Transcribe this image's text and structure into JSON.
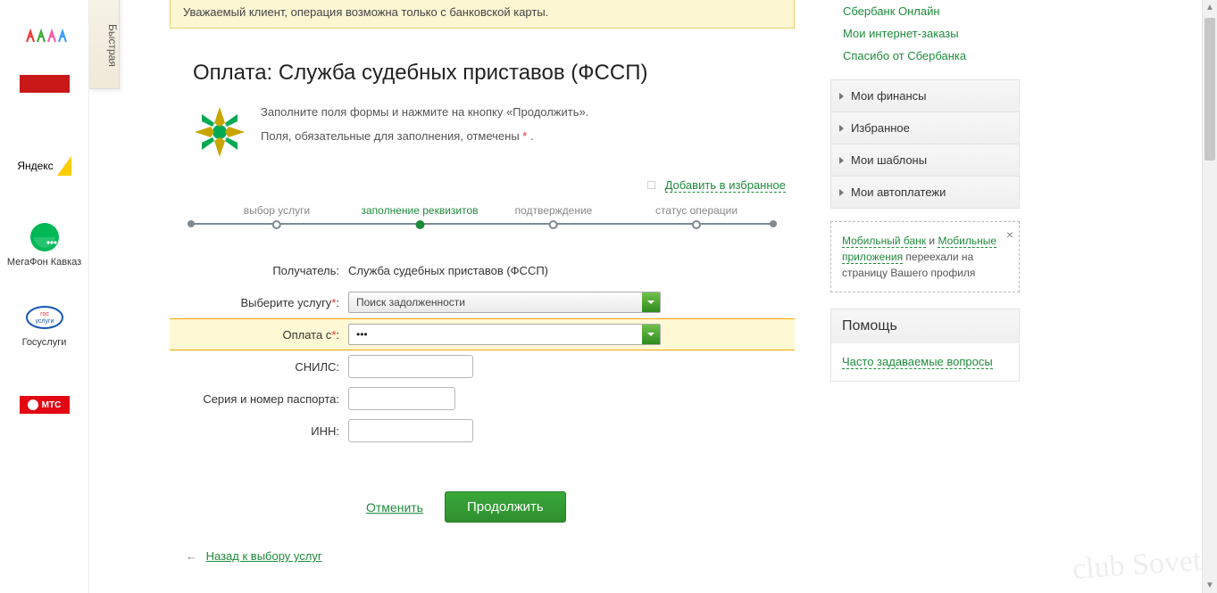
{
  "left_rail": {
    "fast_label": "Быстрая",
    "items": [
      {
        "label": "",
        "kind": "kids"
      },
      {
        "label": "",
        "kind": "promo"
      },
      {
        "label": "Яндекс",
        "kind": "yandex"
      },
      {
        "label": "МегаФон Кавказ",
        "kind": "megafon"
      },
      {
        "label": "Госуслуги",
        "kind": "gosuslugi"
      },
      {
        "label": "",
        "kind": "mts"
      }
    ]
  },
  "alert": "Уважаемый клиент, операция возможна только с банковской карты.",
  "title": "Оплата: Служба судебных приставов (ФССП)",
  "intro1": "Заполните поля формы и нажмите на кнопку «Продолжить».",
  "intro2_pre": "Поля, обязательные для заполнения, отмечены ",
  "intro2_post": " .",
  "fav_label": "Добавить в избранное",
  "steps": [
    "выбор услуги",
    "заполнение реквизитов",
    "подтверждение",
    "статус операции"
  ],
  "active_step_index": 1,
  "form": {
    "recipient_label": "Получатель:",
    "recipient_value": "Служба судебных приставов (ФССП)",
    "service_label": "Выберите услугу",
    "service_value": "Поиск задолженности",
    "payfrom_label": "Оплата с",
    "payfrom_value": "•••",
    "snils_label": "СНИЛС:",
    "passport_label": "Серия и номер паспорта:",
    "inn_label": "ИНН:"
  },
  "actions": {
    "cancel": "Отменить",
    "continue": "Продолжить"
  },
  "back_label": "Назад к выбору услуг",
  "rcol": {
    "quick": [
      "Сбербанк Онлайн",
      "Мои интернет-заказы",
      "Спасибо от Сбербанка"
    ],
    "menu": [
      "Мои финансы",
      "Избранное",
      "Мои шаблоны",
      "Мои автоплатежи"
    ],
    "notice_a1": "Мобильный банк",
    "notice_mid": " и ",
    "notice_a2": "Мобильные приложения",
    "notice_rest": " переехали на страницу Вашего профиля",
    "help_title": "Помощь",
    "help_link": "Часто задаваемые вопросы"
  },
  "watermark": "club Sovet"
}
